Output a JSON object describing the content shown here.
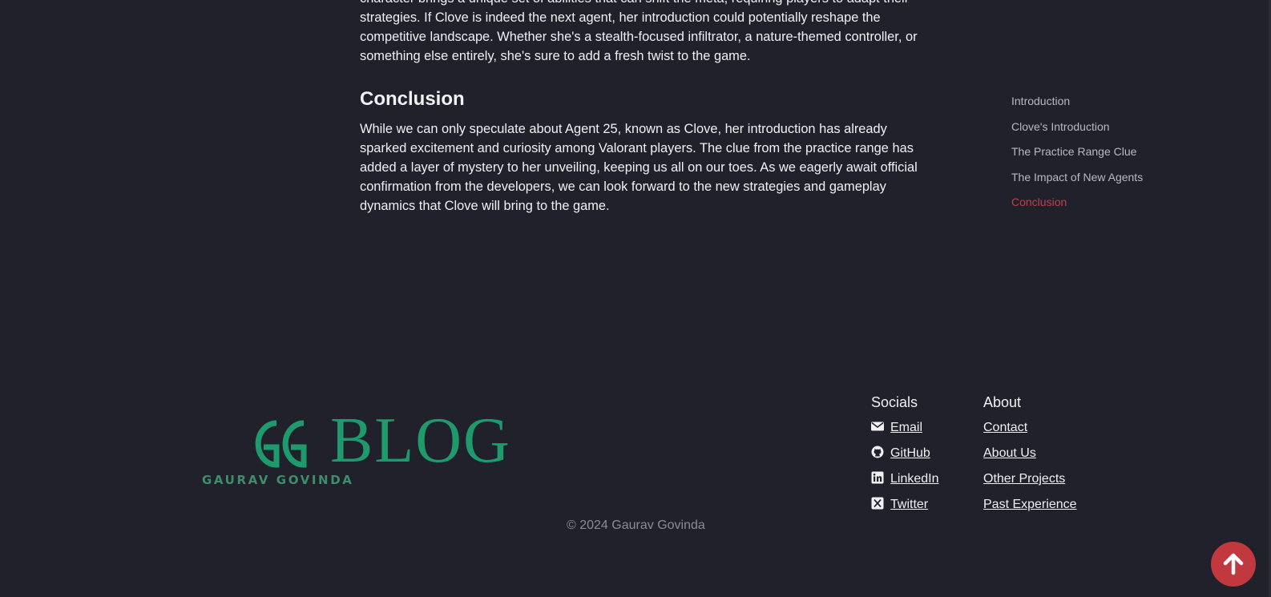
{
  "article": {
    "intro_paragraph": "character brings a unique set of abilities that can shift the meta, requiring players to adapt their strategies. If Clove is indeed the next agent, her introduction could potentially reshape the competitive landscape. Whether she's a stealth-focused infiltrator, a nature-themed controller, or something else entirely, she's sure to add a fresh twist to the game.",
    "conclusion_heading": "Conclusion",
    "conclusion_paragraph": "While we can only speculate about Agent 25, known as Clove, her introduction has already sparked excitement and curiosity among Valorant players. The clue from the practice range has added a layer of mystery to her unveiling, keeping us all on our toes. As we eagerly await official confirmation from the developers, we can look forward to the new strategies and gameplay dynamics that Clove will bring to the game."
  },
  "toc": {
    "items": [
      {
        "label": "Introduction"
      },
      {
        "label": "Clove's Introduction"
      },
      {
        "label": "The Practice Range Clue"
      },
      {
        "label": "The Impact of New Agents"
      },
      {
        "label": "Conclusion"
      }
    ],
    "active_label": "Conclusion"
  },
  "footer": {
    "logo": {
      "title": "BLOG",
      "subtitle": "GAURAV GOVINDA"
    },
    "socials": {
      "heading": "Socials",
      "links": [
        {
          "label": "Email",
          "icon": "envelope-icon"
        },
        {
          "label": "GitHub",
          "icon": "github-icon"
        },
        {
          "label": "LinkedIn",
          "icon": "linkedin-icon"
        },
        {
          "label": "Twitter",
          "icon": "x-twitter-icon"
        }
      ]
    },
    "about": {
      "heading": "About",
      "links": [
        {
          "label": "Contact"
        },
        {
          "label": "About Us"
        },
        {
          "label": "Other Projects"
        },
        {
          "label": "Past Experience"
        }
      ]
    },
    "copyright": "© 2024 Gaurav Govinda"
  },
  "scroll_top": {
    "icon": "arrow-up-icon"
  },
  "colors": {
    "background": "#20212b",
    "accent_red": "#c1383f",
    "logo_green": "#1e9a6c",
    "text": "#f1f1f3",
    "muted": "#8b8c93"
  }
}
